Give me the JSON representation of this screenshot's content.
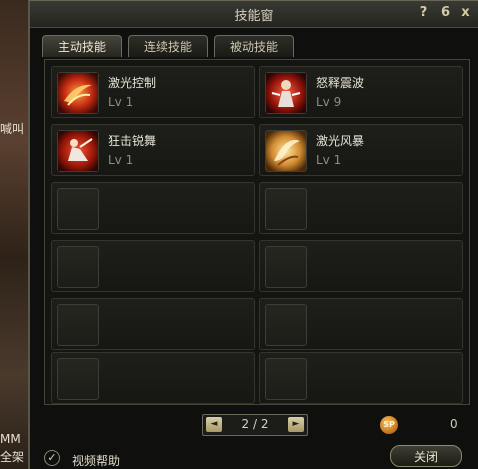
{
  "window": {
    "title": "技能窗"
  },
  "titlebar_buttons": {
    "help": "?",
    "pin": "6",
    "close": "x"
  },
  "tabs": [
    {
      "label": "主动技能",
      "active": true
    },
    {
      "label": "连续技能",
      "active": false
    },
    {
      "label": "被动技能",
      "active": false
    }
  ],
  "skills": [
    {
      "name": "激光控制",
      "level": "Lv 1",
      "icon": "laser-control-icon"
    },
    {
      "name": "怒释震波",
      "level": "Lv 9",
      "icon": "rage-shockwave-icon"
    },
    {
      "name": "狂击锐舞",
      "level": "Lv 1",
      "icon": "frenzy-strike-icon"
    },
    {
      "name": "激光风暴",
      "level": "Lv 1",
      "icon": "laser-storm-icon"
    }
  ],
  "pager": {
    "text": "2 / 2",
    "prev": "◄",
    "next": "►"
  },
  "sp": {
    "badge": "SP",
    "value": "0"
  },
  "footer": {
    "checkbox_label": "视频帮助",
    "close_label": "关闭"
  },
  "background": {
    "left_text_1": "喊叫",
    "left_text_2": "MM",
    "left_text_3": "全架"
  },
  "colors": {
    "accent": "#d4c9a8",
    "frame": "#5a5648"
  }
}
